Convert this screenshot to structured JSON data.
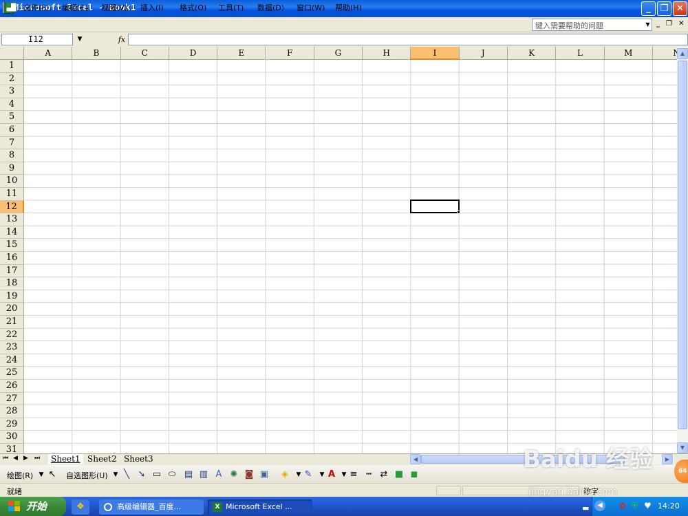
{
  "window": {
    "title": "Microsoft Excel - Book1",
    "icon_label": "X"
  },
  "menu": {
    "items": [
      "文件(F)",
      "编辑(E)",
      "视图(V)",
      "插入(I)",
      "格式(O)",
      "工具(T)",
      "数据(D)",
      "窗口(W)",
      "帮助(H)"
    ],
    "help_placeholder": "键入需要帮助的问题"
  },
  "formula_bar": {
    "name_box": "I12",
    "fx_label": "fx",
    "formula": ""
  },
  "grid": {
    "columns": [
      "A",
      "B",
      "C",
      "D",
      "E",
      "F",
      "G",
      "H",
      "I",
      "J",
      "K",
      "L",
      "M",
      "N"
    ],
    "rows": [
      "1",
      "2",
      "3",
      "4",
      "5",
      "6",
      "7",
      "8",
      "9",
      "10",
      "11",
      "12",
      "13",
      "14",
      "15",
      "16",
      "17",
      "18",
      "19",
      "20",
      "21",
      "22",
      "23",
      "24",
      "25",
      "26",
      "27",
      "28",
      "29",
      "30",
      "31"
    ],
    "active_column": "I",
    "active_row": "12"
  },
  "sheets": {
    "tabs": [
      "Sheet1",
      "Sheet2",
      "Sheet3"
    ],
    "active": "Sheet1"
  },
  "draw_toolbar": {
    "draw_label": "绘图(R)",
    "autoshapes_label": "自选图形(U)"
  },
  "status": {
    "text": "就绪",
    "num": "数字"
  },
  "taskbar": {
    "start_label": "开始",
    "tasks": [
      "高级编辑器_百度...",
      "Microsoft Excel ..."
    ],
    "clock": "14:20"
  },
  "watermark": {
    "text": "Baidu 经验",
    "url": "jingyan.baidu.com",
    "badge": "64"
  },
  "colors": {
    "active_header": "#f8c070",
    "title_bar": "#0054e3",
    "taskbar": "#245edb",
    "start": "#3a8a3a"
  }
}
